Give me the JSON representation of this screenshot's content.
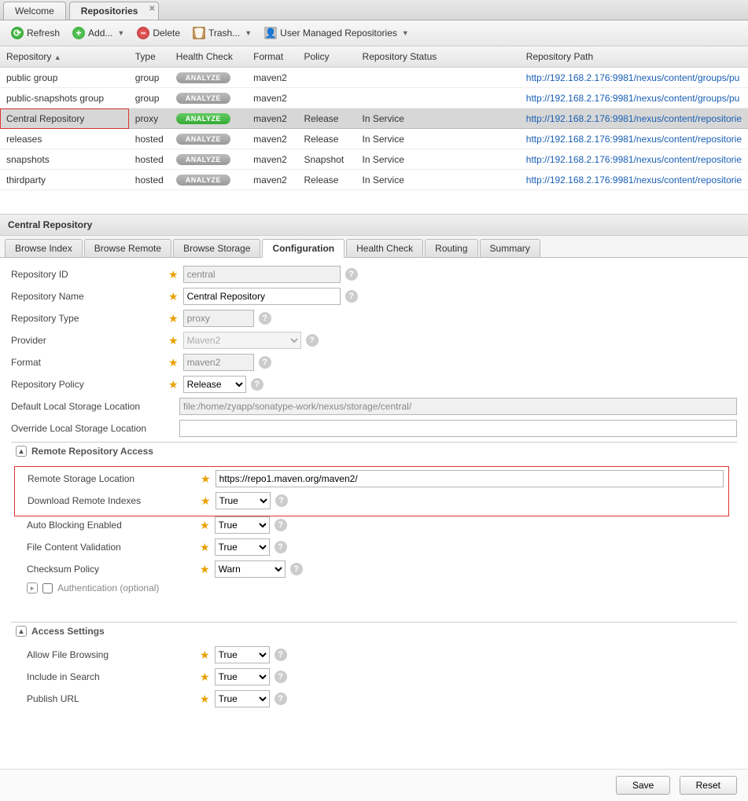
{
  "mainTabs": {
    "welcome": "Welcome",
    "repositories": "Repositories"
  },
  "toolbar": {
    "refresh": "Refresh",
    "add": "Add...",
    "delete": "Delete",
    "trash": "Trash...",
    "userManaged": "User Managed Repositories"
  },
  "grid": {
    "headers": {
      "repository": "Repository",
      "type": "Type",
      "healthCheck": "Health Check",
      "format": "Format",
      "policy": "Policy",
      "status": "Repository Status",
      "path": "Repository Path"
    },
    "analyzeLabel": "ANALYZE",
    "rows": [
      {
        "name": "public group",
        "type": "group",
        "health": "gray",
        "format": "maven2",
        "policy": "",
        "status": "",
        "path": "http://192.168.2.176:9981/nexus/content/groups/pu"
      },
      {
        "name": "public-snapshots group",
        "type": "group",
        "health": "gray",
        "format": "maven2",
        "policy": "",
        "status": "",
        "path": "http://192.168.2.176:9981/nexus/content/groups/pu"
      },
      {
        "name": "Central Repository",
        "type": "proxy",
        "health": "green",
        "format": "maven2",
        "policy": "Release",
        "status": "In Service",
        "path": "http://192.168.2.176:9981/nexus/content/repositorie",
        "selected": true,
        "highlight": true
      },
      {
        "name": "releases",
        "type": "hosted",
        "health": "gray",
        "format": "maven2",
        "policy": "Release",
        "status": "In Service",
        "path": "http://192.168.2.176:9981/nexus/content/repositorie"
      },
      {
        "name": "snapshots",
        "type": "hosted",
        "health": "gray",
        "format": "maven2",
        "policy": "Snapshot",
        "status": "In Service",
        "path": "http://192.168.2.176:9981/nexus/content/repositorie"
      },
      {
        "name": "thirdparty",
        "type": "hosted",
        "health": "gray",
        "format": "maven2",
        "policy": "Release",
        "status": "In Service",
        "path": "http://192.168.2.176:9981/nexus/content/repositorie"
      }
    ]
  },
  "panel": {
    "title": "Central Repository"
  },
  "subTabs": {
    "browseIndex": "Browse Index",
    "browseRemote": "Browse Remote",
    "browseStorage": "Browse Storage",
    "configuration": "Configuration",
    "healthCheck": "Health Check",
    "routing": "Routing",
    "summary": "Summary"
  },
  "form": {
    "labels": {
      "id": "Repository ID",
      "name": "Repository Name",
      "type": "Repository Type",
      "provider": "Provider",
      "format": "Format",
      "policy": "Repository Policy",
      "defaultStorage": "Default Local Storage Location",
      "overrideStorage": "Override Local Storage Location",
      "remoteAccess": "Remote Repository Access",
      "remoteLocation": "Remote Storage Location",
      "downloadIndexes": "Download Remote Indexes",
      "autoBlocking": "Auto Blocking Enabled",
      "fileValidation": "File Content Validation",
      "checksum": "Checksum Policy",
      "authentication": "Authentication (optional)",
      "accessSettings": "Access Settings",
      "allowBrowsing": "Allow File Browsing",
      "includeSearch": "Include in Search",
      "publishUrl": "Publish URL"
    },
    "values": {
      "id": "central",
      "name": "Central Repository",
      "type": "proxy",
      "provider": "Maven2",
      "format": "maven2",
      "policy": "Release",
      "defaultStorage": "file:/home/zyapp/sonatype-work/nexus/storage/central/",
      "overrideStorage": "",
      "remoteLocation": "https://repo1.maven.org/maven2/",
      "downloadIndexes": "True",
      "autoBlocking": "True",
      "fileValidation": "True",
      "checksum": "Warn",
      "allowBrowsing": "True",
      "includeSearch": "True",
      "publishUrl": "True"
    }
  },
  "buttons": {
    "save": "Save",
    "reset": "Reset"
  }
}
